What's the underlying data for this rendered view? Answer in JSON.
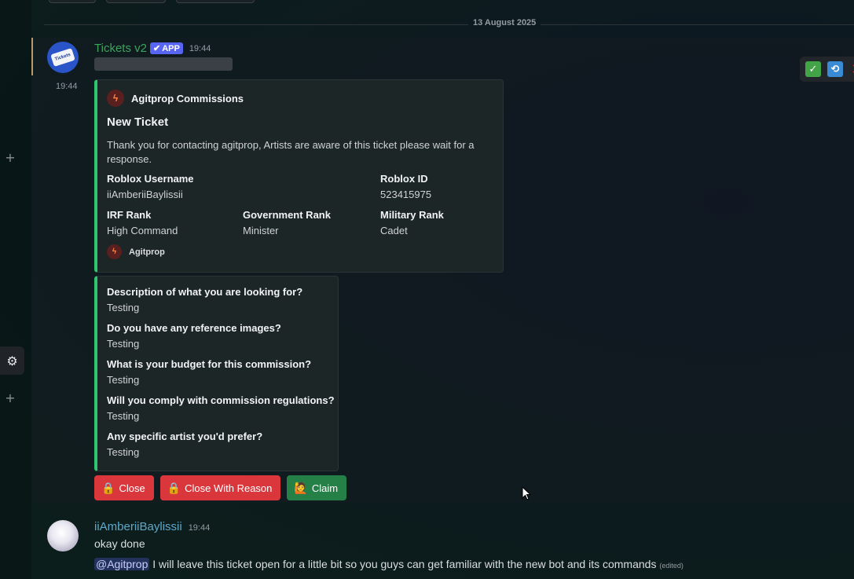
{
  "date_divider": "13 August 2025",
  "bot_message": {
    "author": "Tickets v2",
    "badge": "APP",
    "time": "19:44",
    "side_time": "19:44",
    "avatar_text": "Tickets",
    "embed": {
      "author": "Agitprop Commissions",
      "title": "New Ticket",
      "description": "Thank you for contacting agitprop, Artists are aware of this ticket please wait for a response.",
      "fields": [
        {
          "name": "Roblox Username",
          "value": "iiAmberiiBaylissii"
        },
        {
          "name": "Roblox ID",
          "value": "523415975"
        },
        {
          "name": "IRF Rank",
          "value": "High Command"
        },
        {
          "name": "Government Rank",
          "value": "Minister"
        },
        {
          "name": "Military Rank",
          "value": "Cadet"
        }
      ],
      "footer": "Agitprop",
      "accent_color": "#2dc770"
    },
    "questions": [
      {
        "q": "Description of what you are looking for?",
        "a": "Testing"
      },
      {
        "q": "Do you have any reference images?",
        "a": "Testing"
      },
      {
        "q": "What is your budget for this commission?",
        "a": "Testing"
      },
      {
        "q": "Will you comply with commission regulations?",
        "a": "Testing"
      },
      {
        "q": "Any specific artist you'd prefer?",
        "a": "Testing"
      }
    ],
    "buttons": {
      "close": "Close",
      "close_reason": "Close With Reason",
      "claim": "Claim"
    }
  },
  "user_message": {
    "author": "iiAmberiiBaylissii",
    "time": "19:44",
    "line1": "okay done",
    "mention": "@Agitprop",
    "line2": "I will leave this ticket open for a little bit so you guys can get familiar with the new bot and its commands",
    "edited": "(edited)"
  },
  "icons": {
    "rail_plus_top": "plus-icon",
    "rail_gear": "gear-icon",
    "rail_plus_bottom": "plus-icon",
    "hover_check": "check-icon",
    "hover_repeat": "repeat-icon",
    "hover_close": "close-icon",
    "lock": "lock-icon",
    "claim": "person-icon"
  },
  "colors": {
    "bot_name": "#3ba55d",
    "app_badge": "#5865f2",
    "danger_button": "#da373c",
    "success_button": "#248046",
    "user_name": "#5fa8c9"
  }
}
